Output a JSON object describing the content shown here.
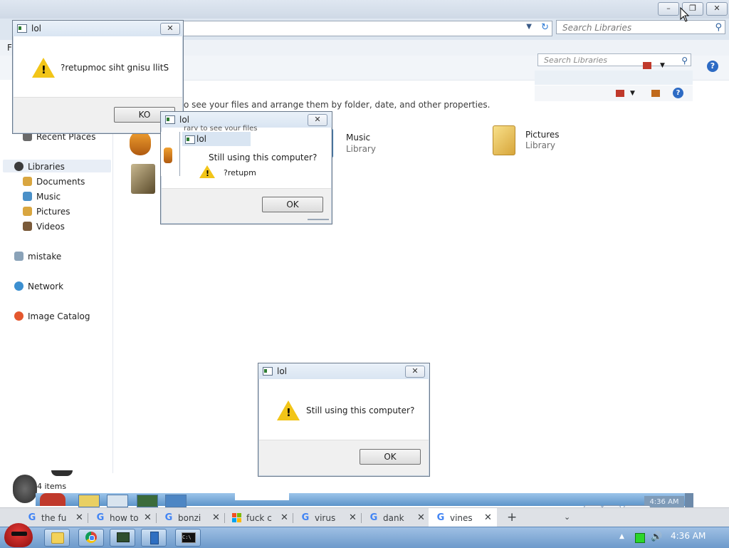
{
  "explorer": {
    "search_placeholder": "Search Libraries",
    "menu_letter": "F",
    "info_text": "o see your files and arrange them by folder, date, and other properties.",
    "nav": {
      "recent_places": "Recent Places",
      "libraries": "Libraries",
      "documents": "Documents",
      "music": "Music",
      "pictures": "Pictures",
      "videos": "Videos",
      "mistake": "mistake",
      "network": "Network",
      "image_catalog": "Image Catalog"
    },
    "libraries": [
      {
        "name": "Music",
        "sub": "Library"
      },
      {
        "name": "Pictures",
        "sub": "Library"
      }
    ],
    "status": "4 items",
    "ghost_clock": "4:36 AM"
  },
  "dialogs": {
    "d1": {
      "title": "lol",
      "message": "?retupmoc siht gnisu llitS",
      "button": "KO"
    },
    "d2": {
      "title": "lol",
      "message": "Still using this computer?",
      "button": "OK",
      "nested_title": "lol",
      "nested_text": "?retupm",
      "fragment": "rary to see your files"
    },
    "d3": {
      "title": "lol",
      "message": "Still using this computer?",
      "button": "OK"
    }
  },
  "browser_tabs": [
    {
      "title": "the fu",
      "icon": "G"
    },
    {
      "title": "how to",
      "icon": "G"
    },
    {
      "title": "bonzi",
      "icon": "G"
    },
    {
      "title": "fuck c",
      "icon": "MS"
    },
    {
      "title": "virus",
      "icon": "G"
    },
    {
      "title": "dank",
      "icon": "G"
    },
    {
      "title": "vines",
      "icon": "G"
    }
  ],
  "taskbar": {
    "clock": "4:36 AM"
  }
}
